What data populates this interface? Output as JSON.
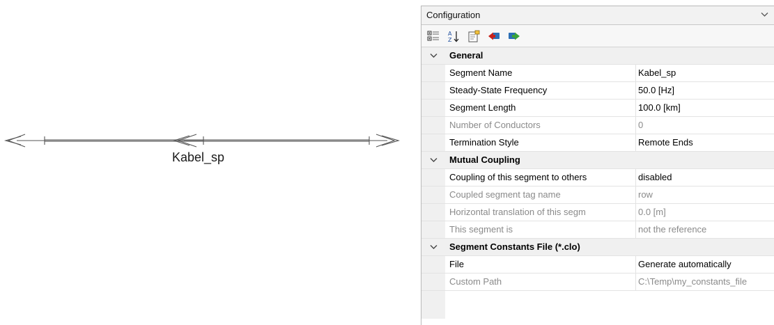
{
  "diagram": {
    "segment_label": "Kabel_sp"
  },
  "panel": {
    "title": "Configuration",
    "toolbar": {
      "buttons": [
        {
          "name": "categorized-icon"
        },
        {
          "name": "sort-alphabetical-icon"
        },
        {
          "name": "property-pages-icon"
        },
        {
          "name": "import-icon"
        },
        {
          "name": "export-icon"
        }
      ]
    },
    "categories": [
      {
        "name": "General",
        "rows": [
          {
            "name": "Segment Name",
            "value": "Kabel_sp",
            "enabled": true
          },
          {
            "name": "Steady-State Frequency",
            "value": "50.0 [Hz]",
            "enabled": true
          },
          {
            "name": "Segment Length",
            "value": "100.0 [km]",
            "enabled": true
          },
          {
            "name": "Number of Conductors",
            "value": "0",
            "enabled": false
          },
          {
            "name": "Termination Style",
            "value": "Remote Ends",
            "enabled": true
          }
        ]
      },
      {
        "name": "Mutual Coupling",
        "rows": [
          {
            "name": "Coupling of this segment to others",
            "value": "disabled",
            "enabled": true
          },
          {
            "name": "Coupled segment tag name",
            "value": "row",
            "enabled": false
          },
          {
            "name": "Horizontal translation of this segm",
            "value": "0.0 [m]",
            "enabled": false
          },
          {
            "name": "This segment is",
            "value": "not the reference",
            "enabled": false
          }
        ]
      },
      {
        "name": "Segment Constants File (*.clo)",
        "rows": [
          {
            "name": "File",
            "value": "Generate automatically",
            "enabled": true
          },
          {
            "name": "Custom Path",
            "value": "C:\\Temp\\my_constants_file",
            "enabled": false
          }
        ]
      }
    ]
  }
}
